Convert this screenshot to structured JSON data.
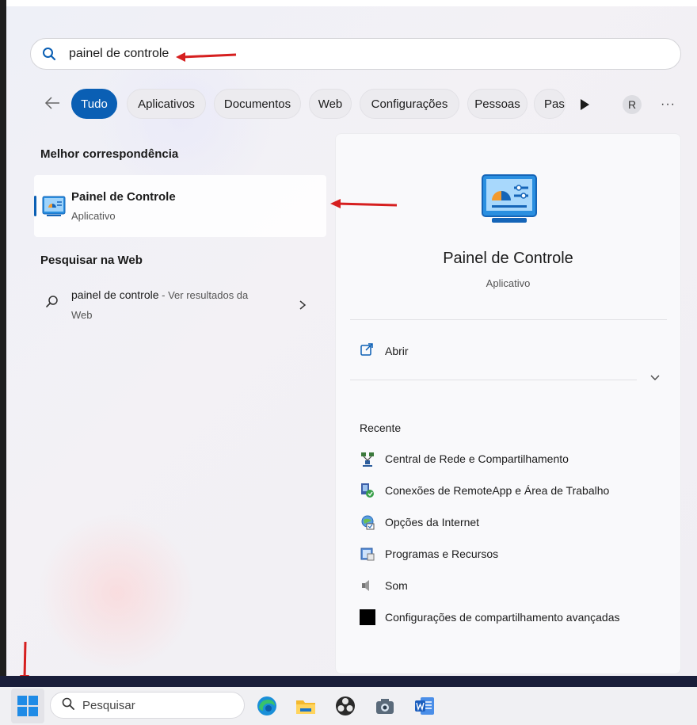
{
  "search": {
    "query": "painel de controle"
  },
  "filters": {
    "items": [
      {
        "label": "Tudo",
        "active": true
      },
      {
        "label": "Aplicativos",
        "active": false
      },
      {
        "label": "Documentos",
        "active": false
      },
      {
        "label": "Web",
        "active": false
      },
      {
        "label": "Configurações",
        "active": false
      },
      {
        "label": "Pessoas",
        "active": false
      },
      {
        "label": "Pas",
        "active": false
      }
    ],
    "avatar_initial": "R",
    "more_label": "···"
  },
  "best_match": {
    "heading": "Melhor correspondência",
    "title": "Painel de Controle",
    "subtitle": "Aplicativo"
  },
  "web_search": {
    "heading": "Pesquisar na Web",
    "query": "painel de controle",
    "hint": " - Ver resultados da",
    "hint_cont": "Web"
  },
  "detail": {
    "title": "Painel de Controle",
    "subtitle": "Aplicativo",
    "open_label": "Abrir",
    "recent_heading": "Recente",
    "recent_items": [
      {
        "label": "Central de Rede e Compartilhamento",
        "icon": "network-center-icon"
      },
      {
        "label": "Conexões de RemoteApp e Área de Trabalho",
        "icon": "remoteapp-icon"
      },
      {
        "label": "Opções da Internet",
        "icon": "internet-options-icon"
      },
      {
        "label": "Programas e Recursos",
        "icon": "programs-features-icon"
      },
      {
        "label": "Som",
        "icon": "sound-icon"
      },
      {
        "label": "Configurações de compartilhamento avançadas",
        "icon": "sharing-settings-icon"
      }
    ]
  },
  "taskbar": {
    "search_placeholder": "Pesquisar",
    "apps": [
      "edge-icon",
      "file-explorer-icon",
      "obs-icon",
      "camera-icon",
      "word-icon"
    ]
  },
  "colors": {
    "accent": "#0a5fb4",
    "annotation_arrow": "#d61f1f"
  }
}
